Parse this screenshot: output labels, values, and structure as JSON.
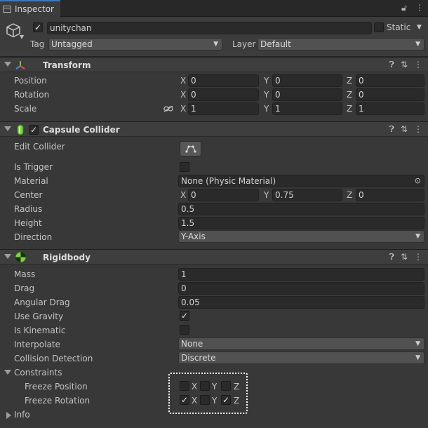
{
  "tab": {
    "title": "Inspector"
  },
  "gameobject": {
    "name": "unitychan",
    "active": true,
    "static_label": "Static",
    "static": false,
    "tag_label": "Tag",
    "tag_value": "Untagged",
    "layer_label": "Layer",
    "layer_value": "Default"
  },
  "transform": {
    "title": "Transform",
    "rows": [
      {
        "label": "Position",
        "x": "0",
        "y": "0",
        "z": "0"
      },
      {
        "label": "Rotation",
        "x": "0",
        "y": "0",
        "z": "0"
      },
      {
        "label": "Scale",
        "x": "1",
        "y": "1",
        "z": "1"
      }
    ]
  },
  "axes": {
    "x": "X",
    "y": "Y",
    "z": "Z"
  },
  "capsule": {
    "title": "Capsule Collider",
    "enabled": true,
    "edit_collider": "Edit Collider",
    "is_trigger": "Is Trigger",
    "material": "Material",
    "material_value": "None (Physic Material)",
    "center": "Center",
    "center_x": "0",
    "center_y": "0.75",
    "center_z": "0",
    "radius": "Radius",
    "radius_value": "0.5",
    "height": "Height",
    "height_value": "1.5",
    "direction": "Direction",
    "direction_value": "Y-Axis"
  },
  "rigidbody": {
    "title": "Rigidbody",
    "mass": "Mass",
    "mass_value": "1",
    "drag": "Drag",
    "drag_value": "0",
    "angular_drag": "Angular Drag",
    "angular_drag_value": "0.05",
    "use_gravity": "Use Gravity",
    "use_gravity_checked": true,
    "is_kinematic": "Is Kinematic",
    "is_kinematic_checked": false,
    "interpolate": "Interpolate",
    "interpolate_value": "None",
    "collision_detection": "Collision Detection",
    "collision_detection_value": "Discrete",
    "constraints": "Constraints",
    "freeze_position": "Freeze Position",
    "freeze_position_xyz": [
      false,
      false,
      false
    ],
    "freeze_rotation": "Freeze Rotation",
    "freeze_rotation_xyz": [
      true,
      false,
      true
    ],
    "info": "Info"
  }
}
